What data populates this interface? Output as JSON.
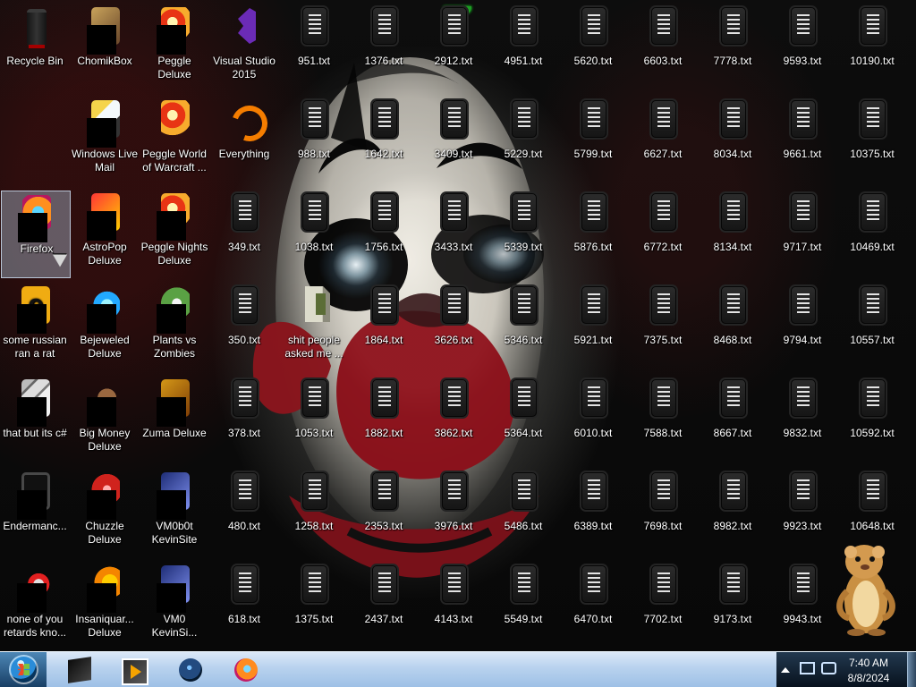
{
  "desktop": {
    "icons": [
      {
        "label": "Recycle Bin",
        "icon": "recycle-bin-icon"
      },
      {
        "label": "ChomikBox",
        "icon": "chomikbox-icon"
      },
      {
        "label": "Peggle Deluxe",
        "icon": "peggle-icon"
      },
      {
        "label": "Visual Studio 2015",
        "icon": "visual-studio-icon"
      },
      {
        "label": "Windows Live Mail",
        "icon": "mail-icon"
      },
      {
        "label": "Peggle World of Warcraft ...",
        "icon": "peggle-world-icon"
      },
      {
        "label": "Everything",
        "icon": "everything-icon"
      },
      {
        "label": "Firefox",
        "icon": "firefox-icon"
      },
      {
        "label": "AstroPop Deluxe",
        "icon": "astropop-icon"
      },
      {
        "label": "Peggle Nights Deluxe",
        "icon": "peggle-nights-icon"
      },
      {
        "label": "some russian ran a rat",
        "icon": "ie-shortcut-icon"
      },
      {
        "label": "Bejeweled Deluxe",
        "icon": "bejeweled-icon"
      },
      {
        "label": "Plants vs Zombies",
        "icon": "plants-vs-zombies-icon"
      },
      {
        "label": "that but its c#",
        "icon": "copy-files-icon"
      },
      {
        "label": "Big Money Deluxe",
        "icon": "money-bag-icon"
      },
      {
        "label": "Zuma Deluxe",
        "icon": "zuma-icon"
      },
      {
        "label": "Endermanc...",
        "icon": "terminal-icon"
      },
      {
        "label": "Chuzzle Deluxe",
        "icon": "chuzzle-icon"
      },
      {
        "label": "VM0b0t KevinSite",
        "icon": "vm-icon"
      },
      {
        "label": "none of you retards kno...",
        "icon": "browser-shortcut-icon"
      },
      {
        "label": "Insaniquar... Deluxe",
        "icon": "fish-icon"
      },
      {
        "label": "VM0 KevinSi...",
        "icon": "vm-icon"
      },
      {
        "label": "951.txt",
        "icon": "text-file-icon"
      },
      {
        "label": "1376.txt",
        "icon": "text-file-icon"
      },
      {
        "label": "2912.txt",
        "icon": "text-file-icon"
      },
      {
        "label": "4951.txt",
        "icon": "text-file-icon"
      },
      {
        "label": "5620.txt",
        "icon": "text-file-icon"
      },
      {
        "label": "6603.txt",
        "icon": "text-file-icon"
      },
      {
        "label": "7778.txt",
        "icon": "text-file-icon"
      },
      {
        "label": "9593.txt",
        "icon": "text-file-icon"
      },
      {
        "label": "10190.txt",
        "icon": "text-file-icon"
      },
      {
        "label": "988.txt",
        "icon": "text-file-icon"
      },
      {
        "label": "1642.txt",
        "icon": "text-file-icon"
      },
      {
        "label": "3409.txt",
        "icon": "text-file-icon"
      },
      {
        "label": "5229.txt",
        "icon": "text-file-icon"
      },
      {
        "label": "5799.txt",
        "icon": "text-file-icon"
      },
      {
        "label": "6627.txt",
        "icon": "text-file-icon"
      },
      {
        "label": "8034.txt",
        "icon": "text-file-icon"
      },
      {
        "label": "9661.txt",
        "icon": "text-file-icon"
      },
      {
        "label": "10375.txt",
        "icon": "text-file-icon"
      },
      {
        "label": "349.txt",
        "icon": "text-file-icon"
      },
      {
        "label": "1038.txt",
        "icon": "text-file-icon"
      },
      {
        "label": "1756.txt",
        "icon": "text-file-icon"
      },
      {
        "label": "3433.txt",
        "icon": "text-file-icon"
      },
      {
        "label": "5339.txt",
        "icon": "text-file-icon"
      },
      {
        "label": "5876.txt",
        "icon": "text-file-icon"
      },
      {
        "label": "6772.txt",
        "icon": "text-file-icon"
      },
      {
        "label": "8134.txt",
        "icon": "text-file-icon"
      },
      {
        "label": "9717.txt",
        "icon": "text-file-icon"
      },
      {
        "label": "10469.txt",
        "icon": "text-file-icon"
      },
      {
        "label": "350.txt",
        "icon": "text-file-icon"
      },
      {
        "label": "shit people asked me ...",
        "icon": "document-file-icon"
      },
      {
        "label": "1864.txt",
        "icon": "text-file-icon"
      },
      {
        "label": "3626.txt",
        "icon": "text-file-icon"
      },
      {
        "label": "5346.txt",
        "icon": "text-file-icon"
      },
      {
        "label": "5921.txt",
        "icon": "text-file-icon"
      },
      {
        "label": "7375.txt",
        "icon": "text-file-icon"
      },
      {
        "label": "8468.txt",
        "icon": "text-file-icon"
      },
      {
        "label": "9794.txt",
        "icon": "text-file-icon"
      },
      {
        "label": "10557.txt",
        "icon": "text-file-icon"
      },
      {
        "label": "378.txt",
        "icon": "text-file-icon"
      },
      {
        "label": "1053.txt",
        "icon": "text-file-icon"
      },
      {
        "label": "1882.txt",
        "icon": "text-file-icon"
      },
      {
        "label": "3862.txt",
        "icon": "text-file-icon"
      },
      {
        "label": "5364.txt",
        "icon": "text-file-icon"
      },
      {
        "label": "6010.txt",
        "icon": "text-file-icon"
      },
      {
        "label": "7588.txt",
        "icon": "text-file-icon"
      },
      {
        "label": "8667.txt",
        "icon": "text-file-icon"
      },
      {
        "label": "9832.txt",
        "icon": "text-file-icon"
      },
      {
        "label": "10592.txt",
        "icon": "text-file-icon"
      },
      {
        "label": "480.txt",
        "icon": "text-file-icon"
      },
      {
        "label": "1258.txt",
        "icon": "text-file-icon"
      },
      {
        "label": "2353.txt",
        "icon": "text-file-icon"
      },
      {
        "label": "3976.txt",
        "icon": "text-file-icon"
      },
      {
        "label": "5486.txt",
        "icon": "text-file-icon"
      },
      {
        "label": "6389.txt",
        "icon": "text-file-icon"
      },
      {
        "label": "7698.txt",
        "icon": "text-file-icon"
      },
      {
        "label": "8982.txt",
        "icon": "text-file-icon"
      },
      {
        "label": "9923.txt",
        "icon": "text-file-icon"
      },
      {
        "label": "10648.txt",
        "icon": "text-file-icon"
      },
      {
        "label": "618.txt",
        "icon": "text-file-icon"
      },
      {
        "label": "1375.txt",
        "icon": "text-file-icon"
      },
      {
        "label": "2437.txt",
        "icon": "text-file-icon"
      },
      {
        "label": "4143.txt",
        "icon": "text-file-icon"
      },
      {
        "label": "5549.txt",
        "icon": "text-file-icon"
      },
      {
        "label": "6470.txt",
        "icon": "text-file-icon"
      },
      {
        "label": "7702.txt",
        "icon": "text-file-icon"
      },
      {
        "label": "9173.txt",
        "icon": "text-file-icon"
      },
      {
        "label": "9943.txt",
        "icon": "text-file-icon"
      }
    ]
  },
  "taskbar": {
    "start_icon": "windows-start-icon",
    "pinned_apps": [
      {
        "icon": "command-window-icon"
      },
      {
        "icon": "media-player-icon"
      },
      {
        "icon": "globe-app-icon"
      },
      {
        "icon": "firefox-icon"
      }
    ],
    "clock": {
      "time": "7:40 AM",
      "date": "8/8/2024"
    }
  },
  "colors": {
    "taskbar_gradient_top": "#dbe8f8",
    "taskbar_gradient_bottom": "#9ec0e6",
    "tray_dark": "#07111c",
    "desktop_text": "#ffffff",
    "selection": "#bed7f0"
  }
}
